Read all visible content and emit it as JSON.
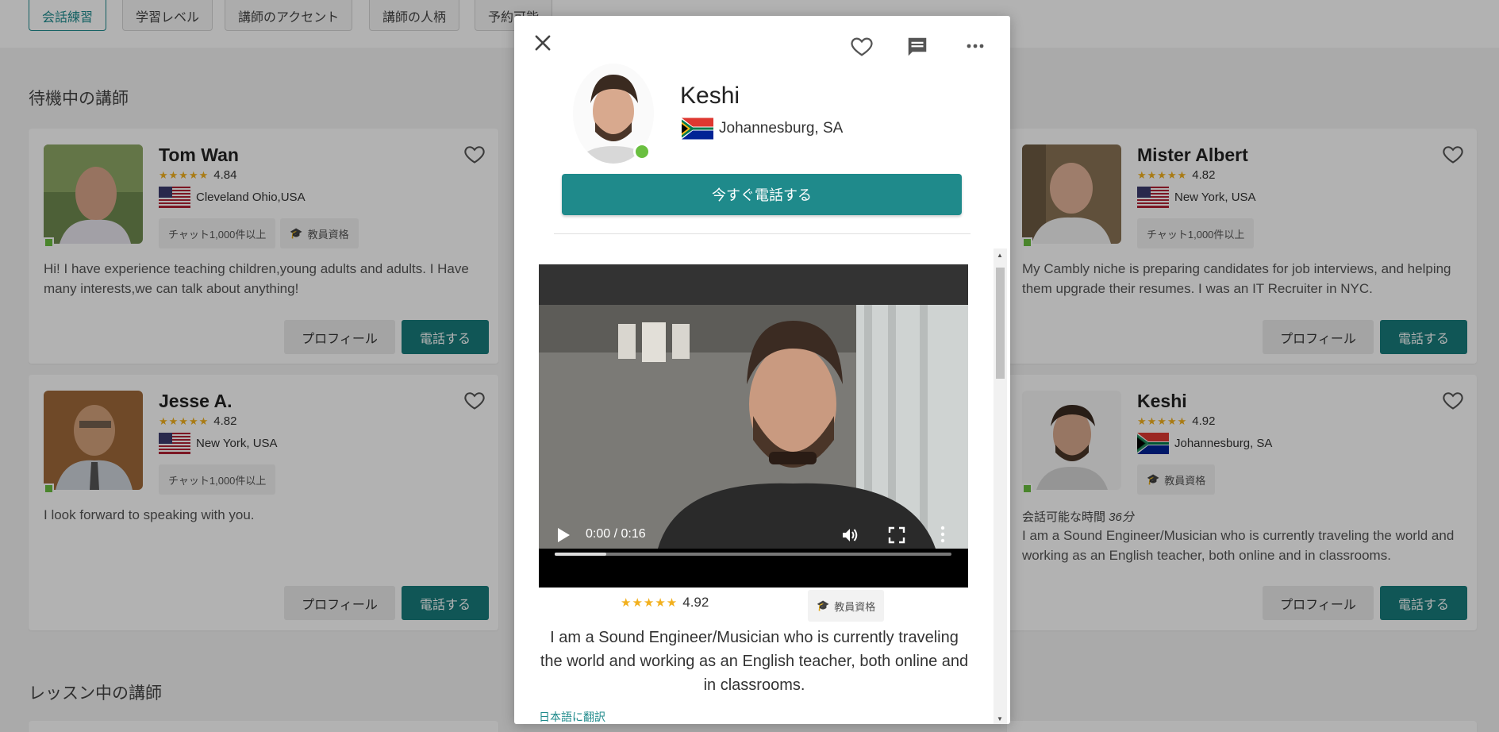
{
  "filters": [
    "会話練習",
    "学習レベル",
    "講師のアクセント",
    "講師の人柄",
    "予約可能"
  ],
  "sections": {
    "waiting": "待機中の講師",
    "in_lesson": "レッスン中の講師"
  },
  "cards": [
    {
      "name": "Tom Wan",
      "rating": "4.84",
      "location": "Cleveland Ohio,USA",
      "flag": "us",
      "badges": [
        "チャット1,000件以上",
        "教員資格"
      ],
      "availability": "",
      "bio": "Hi! I have experience teaching children,young adults and adults. I Have many interests,we can talk about anything!",
      "profile_label": "プロフィール",
      "call_label": "電話する"
    },
    {
      "name": "Jesse A.",
      "rating": "4.82",
      "location": "New York, USA",
      "flag": "us",
      "badges": [
        "チャット1,000件以上"
      ],
      "availability": "",
      "bio": "I look forward to speaking with you.",
      "profile_label": "プロフィール",
      "call_label": "電話する"
    },
    {
      "name": "Mister Albert",
      "rating": "4.82",
      "location": "New York, USA",
      "flag": "us",
      "badges": [
        "チャット1,000件以上"
      ],
      "availability": "",
      "bio": "My Cambly niche is preparing candidates for job interviews, and helping them upgrade their resumes. I was an IT Recruiter in NYC.",
      "profile_label": "プロフィール",
      "call_label": "電話する"
    },
    {
      "name": "Keshi",
      "rating": "4.92",
      "location": "Johannesburg, SA",
      "flag": "za",
      "badges": [
        "教員資格"
      ],
      "availability_prefix": "会話可能な時間 ",
      "availability_value": "36分",
      "bio": "I am a Sound Engineer/Musician who is currently traveling the world and working as an English teacher, both online and in classrooms.",
      "profile_label": "プロフィール",
      "call_label": "電話する"
    }
  ],
  "modal": {
    "name": "Keshi",
    "location": "Johannesburg, SA",
    "call_now_label": "今すぐ電話する",
    "video": {
      "time": "0:00 / 0:16",
      "progress_fraction": 0.13
    },
    "rating": "4.92",
    "badge": "教員資格",
    "bio": "I am a Sound Engineer/Musician who is currently traveling the world and working as an English teacher, both online and in classrooms.",
    "translate_link": "日本語に翻訳"
  },
  "colors": {
    "accent": "#1f8a8b",
    "star": "#f2b01e",
    "online": "#6abf40"
  }
}
